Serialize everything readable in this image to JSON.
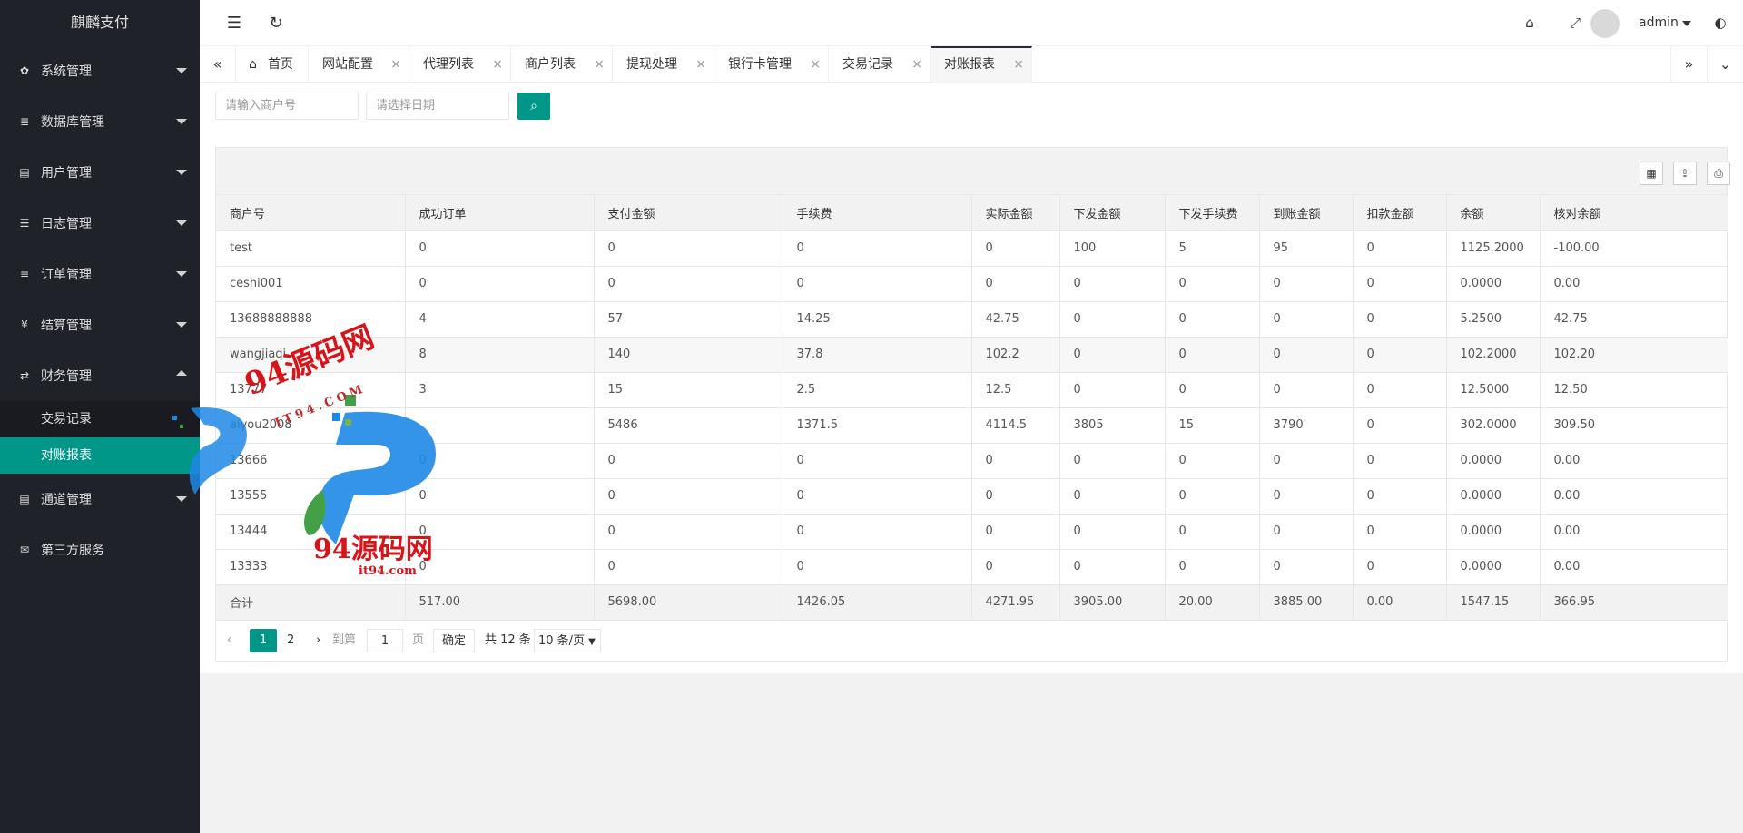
{
  "app": {
    "title": "麒麟支付"
  },
  "sidebar": {
    "items": [
      {
        "label": "系统管理",
        "icon": "gear-icon"
      },
      {
        "label": "数据库管理",
        "icon": "database-icon"
      },
      {
        "label": "用户管理",
        "icon": "user-icon"
      },
      {
        "label": "日志管理",
        "icon": "log-icon"
      },
      {
        "label": "订单管理",
        "icon": "list-icon"
      },
      {
        "label": "结算管理",
        "icon": "yen-icon"
      },
      {
        "label": "财务管理",
        "icon": "exchange-icon"
      },
      {
        "label": "通道管理",
        "icon": "channel-icon"
      },
      {
        "label": "第三方服务",
        "icon": "mail-icon"
      }
    ],
    "finance_sub": [
      {
        "label": "交易记录"
      },
      {
        "label": "对账报表"
      }
    ]
  },
  "header": {
    "user": "admin"
  },
  "tabs": [
    {
      "label": "首页"
    },
    {
      "label": "网站配置"
    },
    {
      "label": "代理列表"
    },
    {
      "label": "商户列表"
    },
    {
      "label": "提现处理"
    },
    {
      "label": "银行卡管理"
    },
    {
      "label": "交易记录"
    },
    {
      "label": "对账报表"
    }
  ],
  "filters": {
    "merchant_placeholder": "请输入商户号",
    "date_placeholder": "请选择日期"
  },
  "table": {
    "columns": [
      "商户号",
      "成功订单",
      "支付金额",
      "手续费",
      "实际金额",
      "下发金额",
      "下发手续费",
      "到账金额",
      "扣款金额",
      "余额",
      "核对余额"
    ],
    "rows": [
      [
        "test",
        "0",
        "0",
        "0",
        "0",
        "100",
        "5",
        "95",
        "0",
        "1125.2000",
        "-100.00"
      ],
      [
        "ceshi001",
        "0",
        "0",
        "0",
        "0",
        "0",
        "0",
        "0",
        "0",
        "0.0000",
        "0.00"
      ],
      [
        "13688888888",
        "4",
        "57",
        "14.25",
        "42.75",
        "0",
        "0",
        "0",
        "0",
        "5.2500",
        "42.75"
      ],
      [
        "wangjiaqi",
        "8",
        "140",
        "37.8",
        "102.2",
        "0",
        "0",
        "0",
        "0",
        "102.2000",
        "102.20"
      ],
      [
        "13777",
        "3",
        "15",
        "2.5",
        "12.5",
        "0",
        "0",
        "0",
        "0",
        "12.5000",
        "12.50"
      ],
      [
        "aiyou2008",
        "",
        "5486",
        "1371.5",
        "4114.5",
        "3805",
        "15",
        "3790",
        "0",
        "302.0000",
        "309.50"
      ],
      [
        "13666",
        "0",
        "0",
        "0",
        "0",
        "0",
        "0",
        "0",
        "0",
        "0.0000",
        "0.00"
      ],
      [
        "13555",
        "0",
        "0",
        "0",
        "0",
        "0",
        "0",
        "0",
        "0",
        "0.0000",
        "0.00"
      ],
      [
        "13444",
        "0",
        "0",
        "0",
        "0",
        "0",
        "0",
        "0",
        "0",
        "0.0000",
        "0.00"
      ],
      [
        "13333",
        "0",
        "0",
        "0",
        "0",
        "0",
        "0",
        "0",
        "0",
        "0.0000",
        "0.00"
      ]
    ],
    "total": [
      "合计",
      "517.00",
      "5698.00",
      "1426.05",
      "4271.95",
      "3905.00",
      "20.00",
      "3885.00",
      "0.00",
      "1547.15",
      "366.95"
    ]
  },
  "pager": {
    "current": "1",
    "next_page": "2",
    "goto_label": "到第",
    "goto_value": "1",
    "page_unit": "页",
    "confirm": "确定",
    "total_text": "共 12 条",
    "page_size": "10 条/页"
  },
  "watermark": {
    "text": "94源码网",
    "domain": "it94.com",
    "small": "IT94.COM"
  }
}
